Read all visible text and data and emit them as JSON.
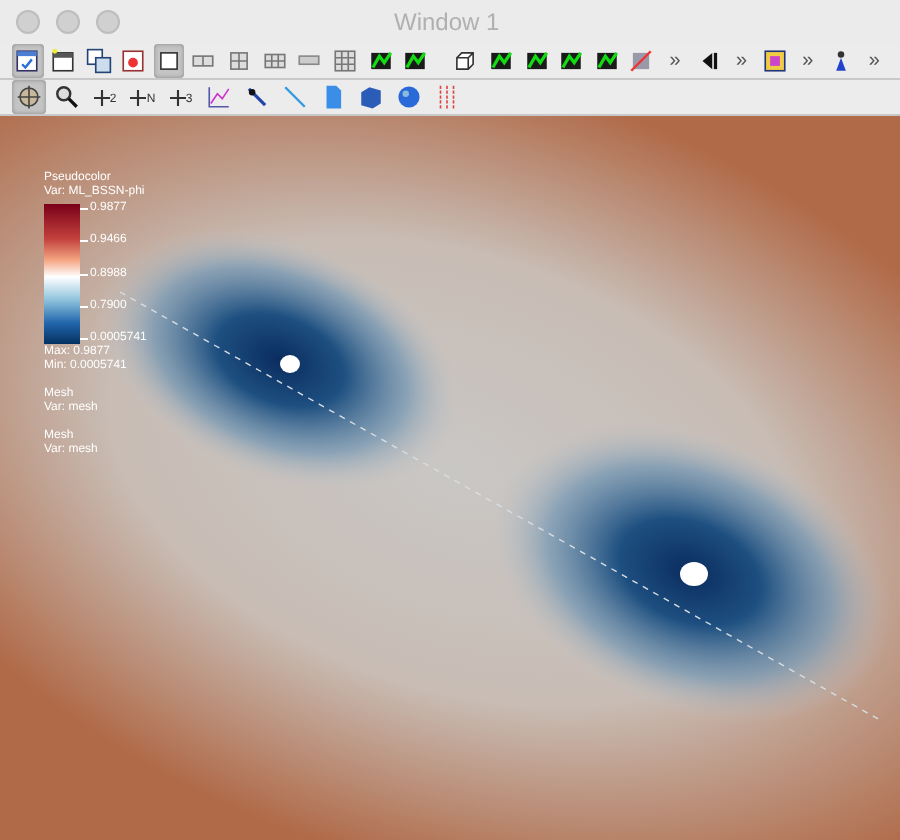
{
  "window": {
    "title": "Window 1"
  },
  "toolbar_top": [
    {
      "kind": "new-window",
      "selected": true
    },
    {
      "kind": "window",
      "selected": false
    },
    {
      "kind": "copy-window",
      "selected": false
    },
    {
      "kind": "delete-window",
      "selected": false
    },
    {
      "kind": "square",
      "selected": true
    },
    {
      "kind": "grid-1x2",
      "selected": false
    },
    {
      "kind": "grid-2x2",
      "selected": false
    },
    {
      "kind": "grid-3x2",
      "selected": false
    },
    {
      "kind": "grid-1x1",
      "selected": false
    },
    {
      "kind": "grid-3x3",
      "selected": false
    },
    {
      "kind": "green-plot",
      "selected": false
    },
    {
      "kind": "green-plot",
      "selected": false
    },
    {
      "kind": "sep"
    },
    {
      "kind": "box",
      "selected": false
    },
    {
      "kind": "green-plot",
      "selected": false
    },
    {
      "kind": "green-plot",
      "selected": false
    },
    {
      "kind": "green-plot",
      "selected": false
    },
    {
      "kind": "green-plot",
      "selected": false
    },
    {
      "kind": "red-plot",
      "selected": false
    },
    {
      "kind": "more",
      "text": "»"
    },
    {
      "kind": "step",
      "selected": false
    },
    {
      "kind": "more",
      "text": "»"
    },
    {
      "kind": "image",
      "selected": false
    },
    {
      "kind": "more",
      "text": "»"
    },
    {
      "kind": "figure",
      "selected": false
    },
    {
      "kind": "more",
      "text": "»"
    }
  ],
  "toolbar_bottom": [
    {
      "kind": "navigate",
      "selected": true
    },
    {
      "kind": "zoom",
      "selected": false
    },
    {
      "kind": "plus",
      "text": "2",
      "selected": false
    },
    {
      "kind": "plus",
      "text": "N",
      "selected": false
    },
    {
      "kind": "plus",
      "text": "3",
      "selected": false
    },
    {
      "kind": "curve",
      "selected": false
    },
    {
      "kind": "pick",
      "selected": false
    },
    {
      "kind": "line",
      "selected": false
    },
    {
      "kind": "doc",
      "selected": false
    },
    {
      "kind": "cube",
      "selected": false
    },
    {
      "kind": "sphere",
      "selected": false
    },
    {
      "kind": "lines",
      "selected": false
    }
  ],
  "legend": {
    "title": "Pseudocolor",
    "variable": "Var: ML_BSSN-phi",
    "ticks": [
      "0.9877",
      "0.9466",
      "0.8988",
      "0.7900",
      "0.0005741"
    ],
    "max": "Max: 0.9877",
    "min": "Min: 0.0005741"
  },
  "mesh_legends": [
    {
      "title": "Mesh",
      "variable": "Var: mesh"
    },
    {
      "title": "Mesh",
      "variable": "Var: mesh"
    }
  ]
}
